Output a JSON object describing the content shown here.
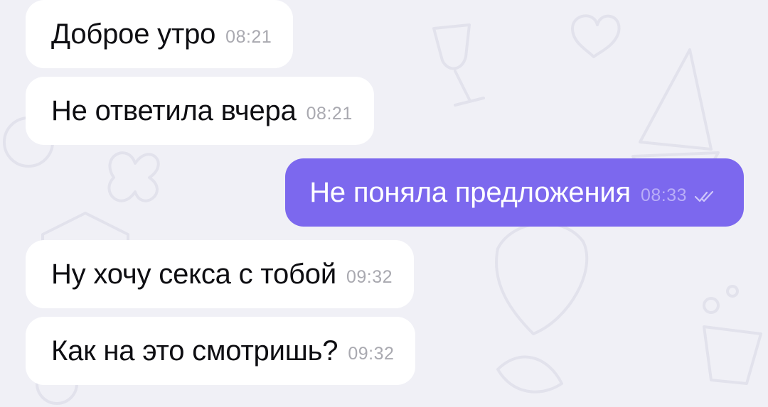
{
  "chat": {
    "messages": [
      {
        "text": "Доброе утро",
        "time": "08:21",
        "direction": "incoming"
      },
      {
        "text": "Не ответила вчера",
        "time": "08:21",
        "direction": "incoming"
      },
      {
        "text": "Не поняла предложения",
        "time": "08:33",
        "direction": "outgoing",
        "status_icon": "double-check-icon"
      },
      {
        "text": "Ну хочу секса с тобой",
        "time": "09:32",
        "direction": "incoming"
      },
      {
        "text": "Как на это смотришь?",
        "time": "09:32",
        "direction": "incoming"
      }
    ]
  },
  "colors": {
    "background": "#f0f0f6",
    "incoming_bubble": "#ffffff",
    "outgoing_bubble": "#7c68ee",
    "incoming_time": "#a9a9b0",
    "outgoing_time": "#b9aef7"
  }
}
